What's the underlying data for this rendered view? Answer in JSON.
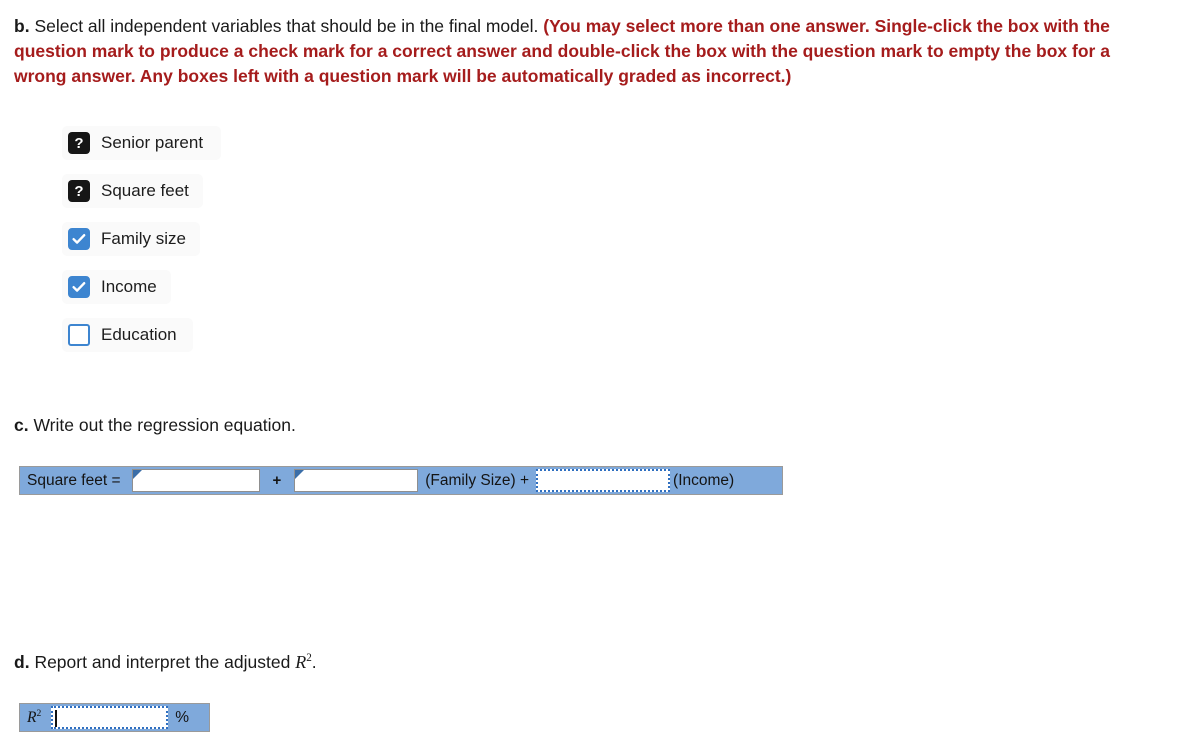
{
  "question_b": {
    "label": "b.",
    "text": "Select all independent variables that should be in the final model.",
    "red_note": "(You may select more than one answer. Single-click the box with the question mark to produce a check mark for a correct answer and double-click the box with the question mark to empty the box for a wrong answer. Any boxes left with a question mark will be automatically graded as incorrect.)",
    "red_color": "#a51c1c",
    "options": [
      {
        "label": "Senior parent",
        "state": "unknown",
        "glyph": "?"
      },
      {
        "label": "Square feet",
        "state": "unknown",
        "glyph": "?"
      },
      {
        "label": "Family size",
        "state": "checked",
        "glyph": "✓"
      },
      {
        "label": "Income",
        "state": "checked",
        "glyph": "✓"
      },
      {
        "label": "Education",
        "state": "empty",
        "glyph": ""
      }
    ]
  },
  "question_c": {
    "label": "c.",
    "text": "Write out the regression equation.",
    "equation_bar": {
      "accent_color": "#7fa9db",
      "lead_label": "Square feet =",
      "input_1": {
        "value": "",
        "placeholder": ""
      },
      "operator_1": "+",
      "input_2": {
        "value": "",
        "placeholder": ""
      },
      "term_1": "(Family Size) +",
      "input_3": {
        "value": "",
        "placeholder": ""
      },
      "term_2": "(Income)"
    }
  },
  "question_d": {
    "label": "d.",
    "text_before": "Report and interpret the adjusted",
    "math_var": "R",
    "math_exp": "2",
    "text_after": ".",
    "r2_bar": {
      "accent_color": "#7fa9db",
      "lead_var": "R",
      "lead_exp": "2",
      "input": {
        "value": "",
        "placeholder": ""
      },
      "unit": "%"
    }
  }
}
